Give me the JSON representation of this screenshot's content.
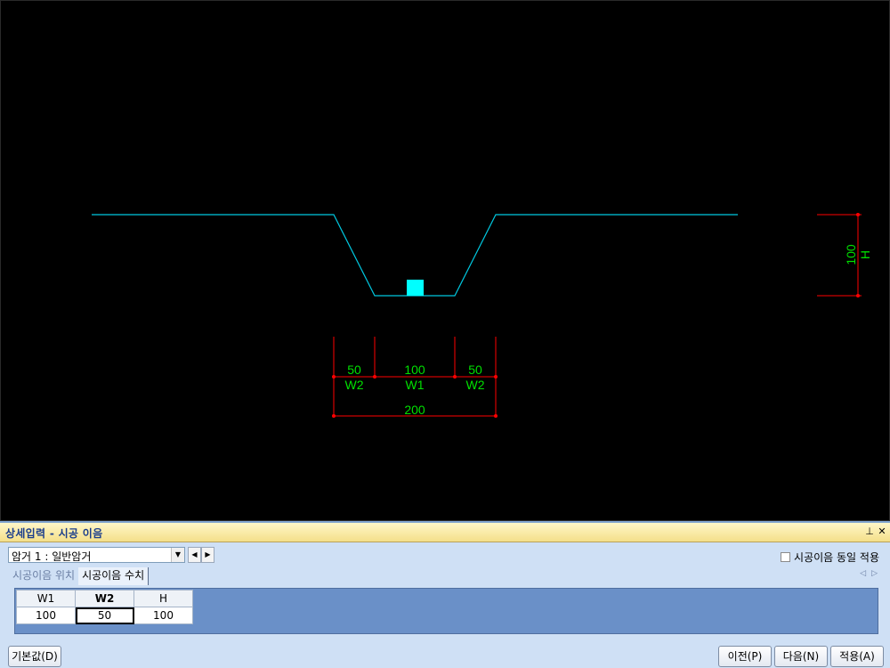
{
  "drawing": {
    "dimension_labels": {
      "w2_left_value": "50",
      "w1_value": "100",
      "w2_right_value": "50",
      "w2_left_name": "W2",
      "w1_name": "W1",
      "w2_right_name": "W2",
      "total_value": "200",
      "h_value": "100",
      "h_name": "H"
    },
    "colors": {
      "profile": "#00c8e0",
      "joint_marker": "#00ffff",
      "dimension_line": "#ff0000",
      "dimension_text": "#00e000",
      "background": "#000000"
    }
  },
  "panel": {
    "title": "상세입력 - 시공 이음",
    "pin_icon": "pin-icon",
    "close_icon": "close-icon",
    "type_select": {
      "value": "암거 1 : 일반암거"
    },
    "same_joint_checkbox": {
      "label": "시공이음 동일 적용",
      "checked": false
    },
    "tabs": [
      {
        "label": "시공이음 위치",
        "active": false
      },
      {
        "label": "시공이음 수치",
        "active": true
      }
    ],
    "grid": {
      "headers": [
        "W1",
        "W2",
        "H"
      ],
      "values": [
        "100",
        "50",
        "100"
      ],
      "selected_column": 1
    },
    "buttons": {
      "default": "기본값(D)",
      "prev": "이전(P)",
      "next": "다음(N)",
      "apply": "적용(A)"
    }
  }
}
